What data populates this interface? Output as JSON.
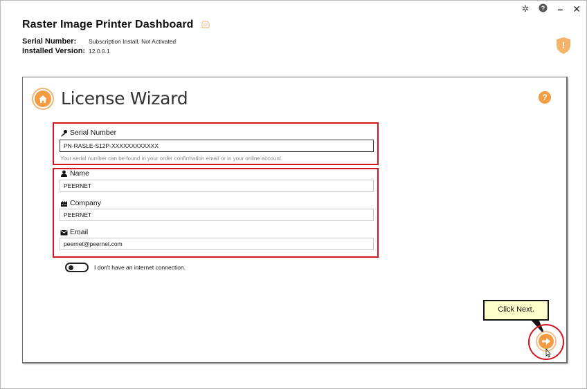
{
  "window": {
    "controls": {
      "settings_glyph": "✲",
      "help_glyph": "?",
      "minimize_glyph": "–",
      "close_glyph": "✕"
    }
  },
  "header": {
    "title": "Raster Image Printer Dashboard",
    "serial_label": "Serial Number:",
    "serial_value": "Subscription Install, Not Activated",
    "version_label": "Installed Version:",
    "version_value": "12.0.0.1",
    "warning_glyph": "!"
  },
  "wizard": {
    "title": "License Wizard",
    "help_glyph": "?",
    "serial": {
      "label": "Serial Number",
      "value": "PN-RASLE-S12P-XXXXXXXXXXXX",
      "hint": "Your serial number can be found in your order confirmation email or in your online account."
    },
    "name": {
      "label": "Name",
      "value": "PEERNET"
    },
    "company": {
      "label": "Company",
      "value": "PEERNET"
    },
    "email": {
      "label": "Email",
      "value": "peernet@peernet.com"
    },
    "offline_toggle": {
      "label": "I don't have an internet connection.",
      "checked": false
    },
    "callout": "Click Next."
  },
  "colors": {
    "accent": "#f39c43",
    "highlight_red": "#d4141e",
    "callout_bg": "#ffffcc"
  }
}
